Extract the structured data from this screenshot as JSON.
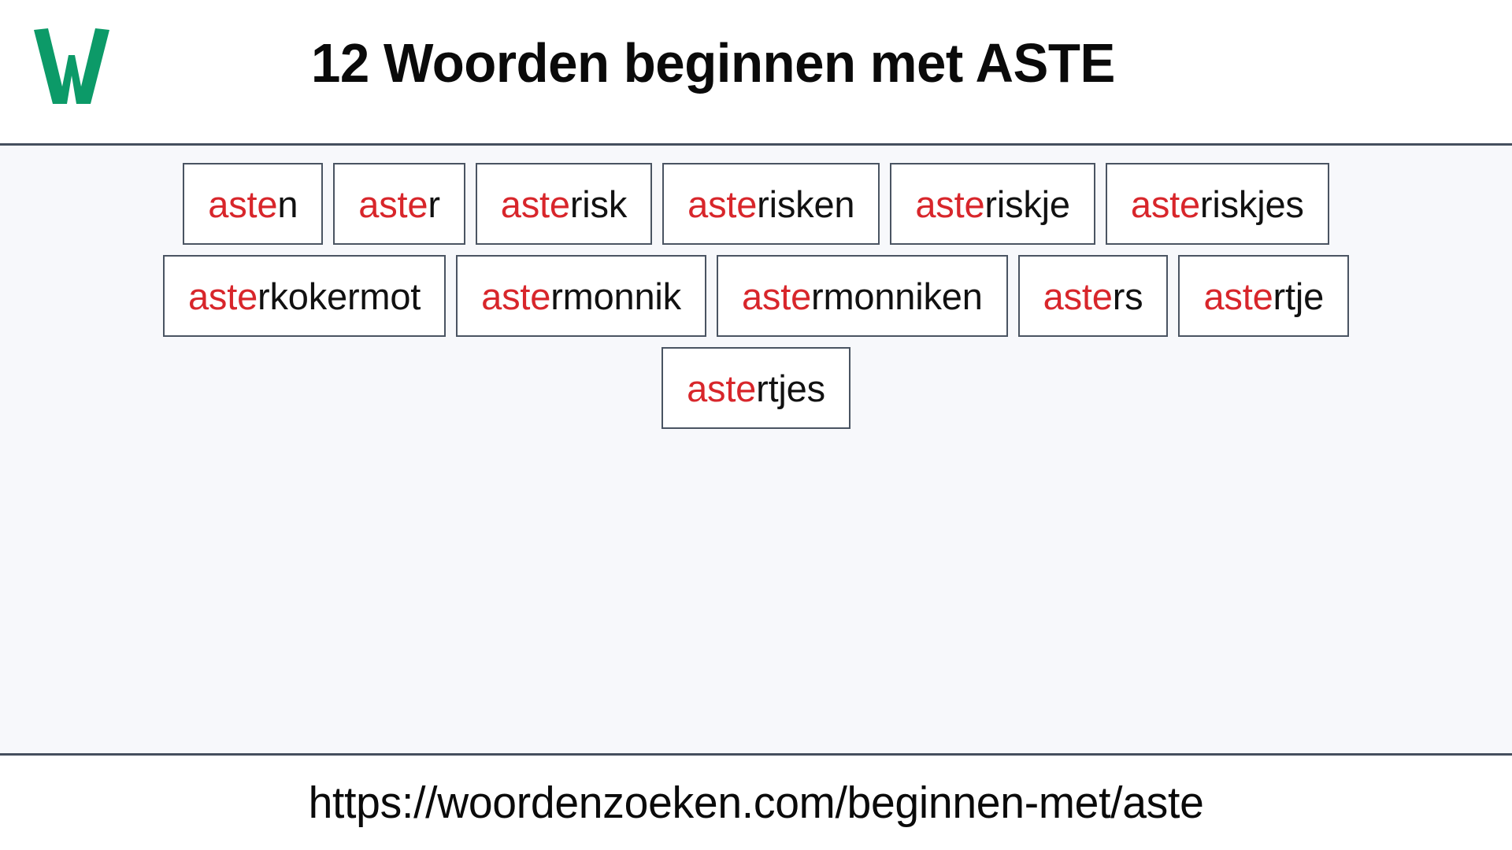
{
  "header": {
    "logo_icon": "w-logo-icon",
    "logo_letter": "W",
    "logo_color": "#0C9A68",
    "title": "12 Woorden beginnen met ASTE"
  },
  "main": {
    "background_color": "#F7F8FB",
    "highlight_color": "#D8262B",
    "text_color": "#111111",
    "border_color": "#4A5462",
    "prefix": "aste",
    "word_count": 12,
    "rows": [
      [
        {
          "prefix": "aste",
          "rest": "n",
          "full": "asten"
        },
        {
          "prefix": "aste",
          "rest": "r",
          "full": "aster"
        },
        {
          "prefix": "aste",
          "rest": "risk",
          "full": "asterisk"
        },
        {
          "prefix": "aste",
          "rest": "risken",
          "full": "asterisken"
        },
        {
          "prefix": "aste",
          "rest": "riskje",
          "full": "asteriskje"
        },
        {
          "prefix": "aste",
          "rest": "riskjes",
          "full": "asteriskjes"
        }
      ],
      [
        {
          "prefix": "aste",
          "rest": "rkokermot",
          "full": "asterkokermot"
        },
        {
          "prefix": "aste",
          "rest": "rmonnik",
          "full": "astermonnik"
        },
        {
          "prefix": "aste",
          "rest": "rmonniken",
          "full": "astermonniken"
        },
        {
          "prefix": "aste",
          "rest": "rs",
          "full": "asters"
        },
        {
          "prefix": "aste",
          "rest": "rtje",
          "full": "astertje"
        }
      ],
      [
        {
          "prefix": "aste",
          "rest": "rtjes",
          "full": "astertjes"
        }
      ]
    ]
  },
  "footer": {
    "url": "https://woordenzoeken.com/beginnen-met/aste"
  }
}
